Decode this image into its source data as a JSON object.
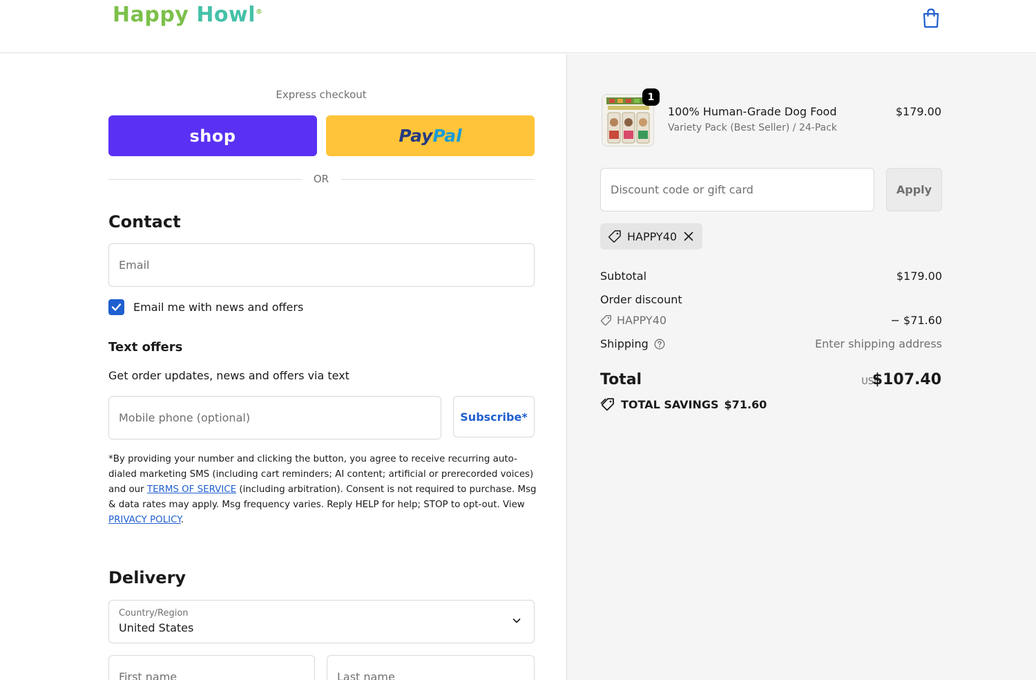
{
  "header": {
    "logo_word1": "Happy",
    "logo_word2": "Howl",
    "logo_mark": "®",
    "cart_icon": "shopping-bag-icon"
  },
  "express": {
    "label": "Express checkout",
    "shop_label": "shop",
    "paypal_part1": "Pay",
    "paypal_part2": "Pal",
    "or_label": "OR"
  },
  "contact": {
    "heading": "Contact",
    "email_placeholder": "Email",
    "newsletter_label": "Email me with news and offers",
    "newsletter_checked": true
  },
  "text_offers": {
    "heading": "Text offers",
    "description": "Get order updates, news and offers via text",
    "phone_placeholder": "Mobile phone (optional)",
    "subscribe_label": "Subscribe*",
    "legal_part1": "*By providing your number and clicking the button, you agree to receive recurring auto-dialed marketing SMS (including cart reminders; AI content; artificial or prerecorded voices) and our ",
    "terms_link": "TERMS OF SERVICE",
    "legal_part2": " (including arbitration). Consent is not required to purchase. Msg & data rates may apply. Msg frequency varies. Reply HELP for help; STOP to opt-out. View ",
    "privacy_link": "PRIVACY POLICY",
    "legal_end": "."
  },
  "delivery": {
    "heading": "Delivery",
    "country_label": "Country/Region",
    "country_value": "United States",
    "first_name_placeholder": "First name",
    "last_name_placeholder": "Last name"
  },
  "summary": {
    "item": {
      "quantity": "1",
      "name": "100% Human-Grade Dog Food",
      "variant": "Variety Pack (Best Seller) / 24-Pack",
      "price": "$179.00"
    },
    "discount_placeholder": "Discount code or gift card",
    "apply_label": "Apply",
    "applied_code": "HAPPY40",
    "subtotal_label": "Subtotal",
    "subtotal_value": "$179.00",
    "order_discount_label": "Order discount",
    "discount_code": "HAPPY40",
    "discount_value": "− $71.60",
    "shipping_label": "Shipping",
    "shipping_value": "Enter shipping address",
    "total_label": "Total",
    "currency": "USD",
    "total_value": "$107.40",
    "savings_label": "TOTAL SAVINGS",
    "savings_value": "$71.60"
  },
  "colors": {
    "shop_purple": "#5a31f4",
    "paypal_yellow": "#ffc439",
    "link_blue": "#1f5fcf",
    "logo_green": "#7cc04a",
    "logo_teal": "#45c1a8"
  }
}
